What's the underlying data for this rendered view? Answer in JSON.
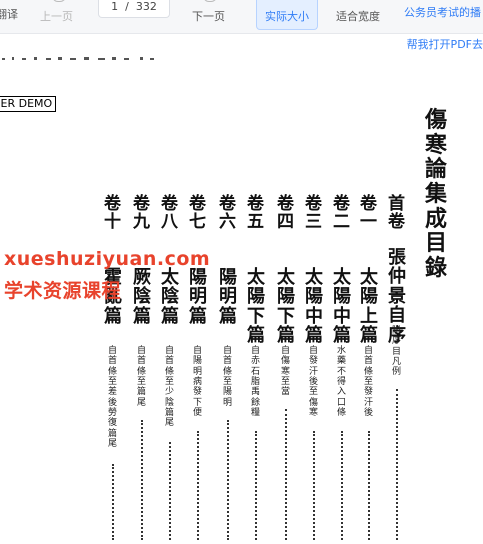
{
  "toolbar": {
    "translate_label": "翻译",
    "prev_label": "上一页",
    "page_current": "1",
    "page_total": "332",
    "next_label": "下一页",
    "actual_size_label": "实际大小",
    "fit_width_label": "适合宽度"
  },
  "promo": {
    "line1": "公务员考试的播",
    "line2": "帮我打开PDF去"
  },
  "document": {
    "demo_label": "GER DEMO",
    "title": "傷寒論集成目錄",
    "volumes": [
      {
        "vol": "首卷",
        "chapter": "張仲景自序",
        "note": "附序目凡例"
      },
      {
        "vol": "卷一",
        "chapter": "太陽上篇",
        "note": "自首條至發汗後"
      },
      {
        "vol": "卷二",
        "chapter": "太陽中篇",
        "note": "水藥不得入口條"
      },
      {
        "vol": "卷三",
        "chapter": "太陽中篇",
        "note": "自發汗後至傷寒"
      },
      {
        "vol": "卷四",
        "chapter": "太陽下篇",
        "note": "自傷寒至當"
      },
      {
        "vol": "卷五",
        "chapter": "太陽下篇",
        "note": "自赤石脂禹餘糧"
      },
      {
        "vol": "卷六",
        "chapter": "陽明篇",
        "note": "自首條至陽明"
      },
      {
        "vol": "卷七",
        "chapter": "陽明篇",
        "note": "自陽明病發下便"
      },
      {
        "vol": "卷八",
        "chapter": "太陰篇",
        "note": "自首條至少陰篇尾"
      },
      {
        "vol": "卷九",
        "chapter": "厥陰篇",
        "note": "自首條至篇尾"
      },
      {
        "vol": "卷十",
        "chapter": "霍亂篇",
        "note": "自首條至差後勞復篇尾"
      }
    ]
  },
  "watermark": {
    "line1": "xueshuziyuan.com",
    "line2": "学术资源课程"
  },
  "colors": {
    "accent": "#2f7cf6",
    "watermark": "#e8432c",
    "toolbar_bg": "#f6f7f9"
  }
}
